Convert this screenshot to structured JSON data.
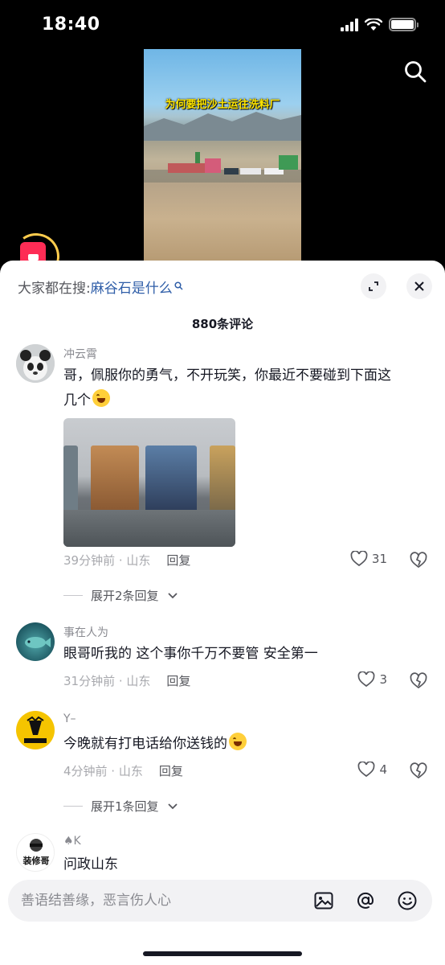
{
  "status_bar": {
    "time": "18:40"
  },
  "video": {
    "caption": "为何要把沙土运往洗料厂"
  },
  "search_suggest": {
    "prefix": "大家都在搜:",
    "query": "麻谷石是什么"
  },
  "comments_header": {
    "count_label": "880条评论"
  },
  "comments": [
    {
      "username": "冲云霄",
      "text": "哥，佩服你的勇气，不开玩笑，你最近不要碰到下面这几个",
      "time_location": "39分钟前 · 山东",
      "reply_label": "回复",
      "likes": "31",
      "more_replies": "展开2条回复"
    },
    {
      "username": "事在人为",
      "text": "眼哥听我的 这个事你千万不要管 安全第一",
      "time_location": "31分钟前 · 山东",
      "reply_label": "回复",
      "likes": "3"
    },
    {
      "username": "Y–",
      "text": "今晚就有打电话给你送钱的",
      "time_location": "4分钟前 · 山东",
      "reply_label": "回复",
      "likes": "4",
      "more_replies": "展开1条回复"
    },
    {
      "username": "♠K",
      "text": "问政山东",
      "avatar_text": "装修哥"
    }
  ],
  "input": {
    "placeholder": "善语结善缘，恶言伤人心"
  },
  "colors": {
    "accent_red": "#fe2c55",
    "link_blue": "#2f5ea8",
    "text_primary": "#161823",
    "text_secondary": "#8a8b91"
  }
}
